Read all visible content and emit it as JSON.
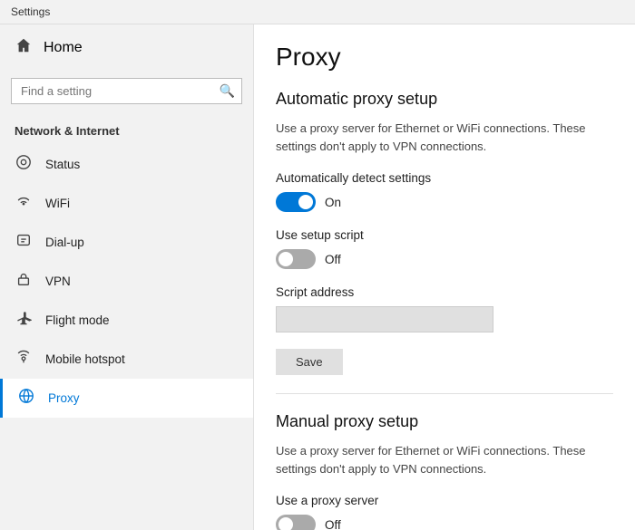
{
  "titleBar": {
    "label": "Settings"
  },
  "sidebar": {
    "homeLabel": "Home",
    "searchPlaceholder": "Find a setting",
    "sectionTitle": "Network & Internet",
    "items": [
      {
        "id": "status",
        "label": "Status",
        "icon": "⊕"
      },
      {
        "id": "wifi",
        "label": "WiFi",
        "icon": "📶"
      },
      {
        "id": "dialup",
        "label": "Dial-up",
        "icon": "📞"
      },
      {
        "id": "vpn",
        "label": "VPN",
        "icon": "🔒"
      },
      {
        "id": "flightmode",
        "label": "Flight mode",
        "icon": "✈"
      },
      {
        "id": "mobilehotspot",
        "label": "Mobile hotspot",
        "icon": "📡"
      },
      {
        "id": "proxy",
        "label": "Proxy",
        "icon": "🌐",
        "active": true
      }
    ]
  },
  "content": {
    "pageTitle": "Proxy",
    "automaticSection": {
      "title": "Automatic proxy setup",
      "description": "Use a proxy server for Ethernet or WiFi connections. These settings don't apply to VPN connections.",
      "autoDetect": {
        "label": "Automatically detect settings",
        "state": "on",
        "statusOn": "On",
        "statusOff": "Off"
      },
      "setupScript": {
        "label": "Use setup script",
        "state": "off",
        "statusOn": "On",
        "statusOff": "Off"
      },
      "scriptAddress": {
        "label": "Script address",
        "placeholder": ""
      },
      "saveButton": "Save"
    },
    "manualSection": {
      "title": "Manual proxy setup",
      "description": "Use a proxy server for Ethernet or WiFi connections. These settings don't apply to VPN connections.",
      "useProxyServer": {
        "label": "Use a proxy server",
        "state": "off",
        "statusOff": "Off"
      }
    }
  }
}
